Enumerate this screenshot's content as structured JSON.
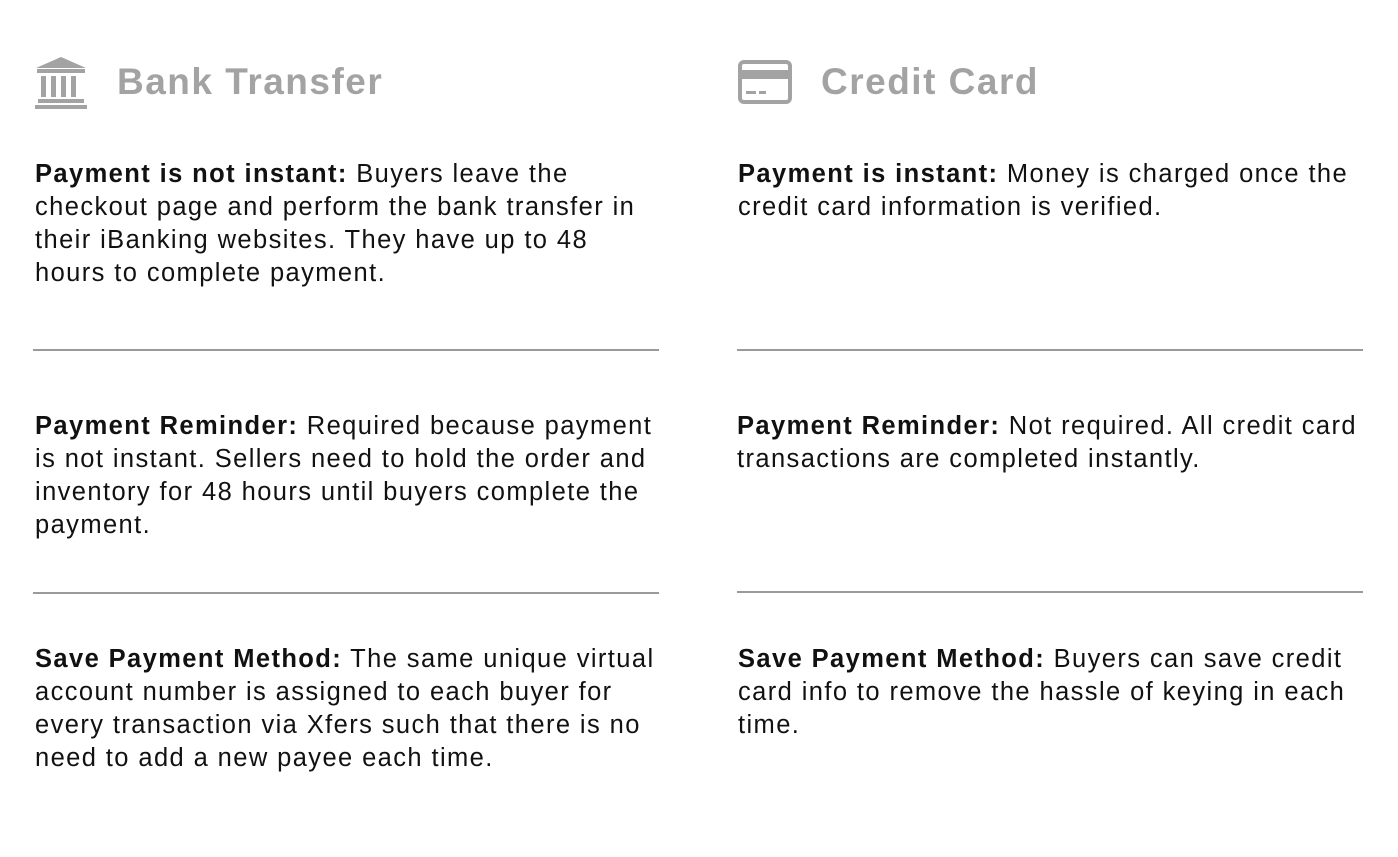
{
  "bank_transfer": {
    "title": "Bank Transfer",
    "icon": "bank-icon",
    "sections": [
      {
        "label": "Payment is not instant:",
        "text": " Buyers leave the checkout page and perform the bank transfer in their iBanking websites. They have up to 48 hours to complete payment."
      },
      {
        "label": "Payment Reminder:",
        "text": " Required because payment is not instant. Sellers need to hold the order and inventory for 48 hours until buyers complete the payment."
      },
      {
        "label": "Save Payment Method:",
        "text": " The same unique virtual account number is assigned to each buyer for every transaction via Xfers such that there is no need to add a new payee each time."
      }
    ]
  },
  "credit_card": {
    "title": "Credit Card",
    "icon": "credit-card-icon",
    "sections": [
      {
        "label": "Payment is instant:",
        "text": " Money is charged once the credit card information is verified."
      },
      {
        "label": "Payment Reminder:",
        "text": " Not required. All credit card transactions are completed instantly."
      },
      {
        "label": "Save Payment Method:",
        "text": " Buyers can save credit card info to remove the hassle of keying in each time."
      }
    ]
  },
  "colors": {
    "heading": "#a3a3a3",
    "body_text": "#111111",
    "divider": "#9a9a9a"
  }
}
